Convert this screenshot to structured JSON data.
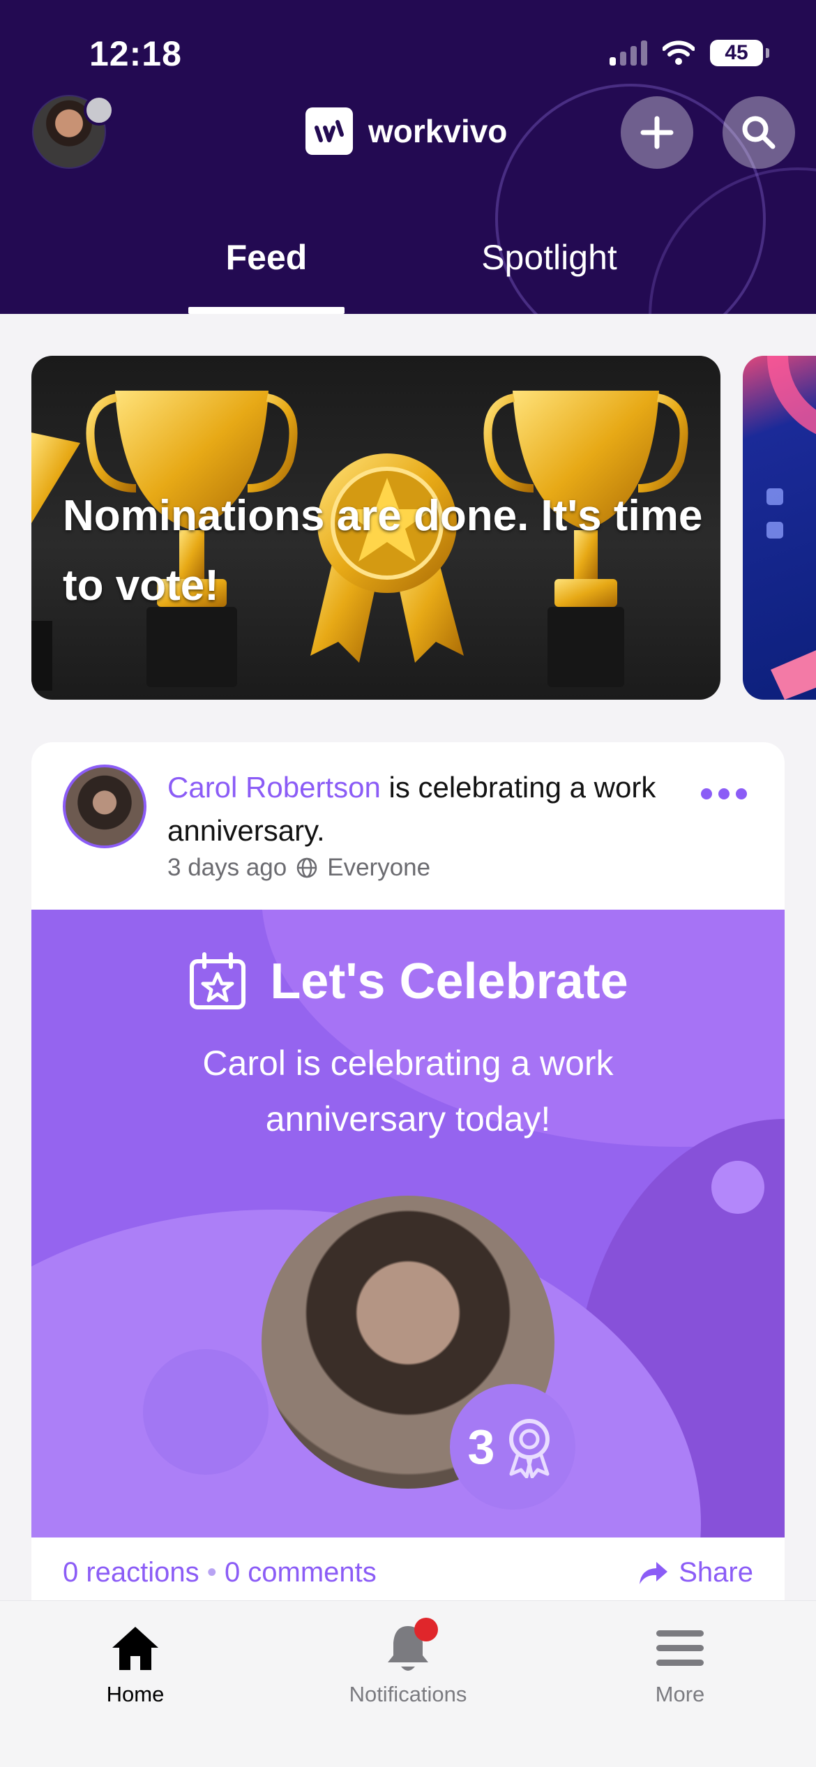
{
  "status_bar": {
    "time": "12:18",
    "battery": "45"
  },
  "header": {
    "brand_name": "workvivo",
    "tabs": [
      {
        "label": "Feed",
        "active": true
      },
      {
        "label": "Spotlight",
        "active": false
      }
    ]
  },
  "banner": {
    "text": "Nominations are done. It's time to vote!"
  },
  "post": {
    "author": "Carol Robertson",
    "action": " is celebrating a work anniversary.",
    "time_ago": "3 days ago",
    "audience": "Everyone",
    "celebration": {
      "title": "Let's Celebrate",
      "subtitle": "Carol is celebrating a work anniversary today!",
      "years": "3"
    },
    "reactions": "0 reactions",
    "separator": "•",
    "comments": "0 comments",
    "share_label": "Share"
  },
  "bottom_nav": {
    "items": [
      {
        "label": "Home",
        "icon": "home-icon",
        "active": true
      },
      {
        "label": "Notifications",
        "icon": "bell-icon",
        "active": false
      },
      {
        "label": "More",
        "icon": "menu-icon",
        "active": false
      }
    ]
  },
  "colors": {
    "header_bg": "#230a52",
    "accent": "#8b5cf6",
    "celebrate_bg": "#9564ef",
    "notification_dot": "#e0262b"
  }
}
